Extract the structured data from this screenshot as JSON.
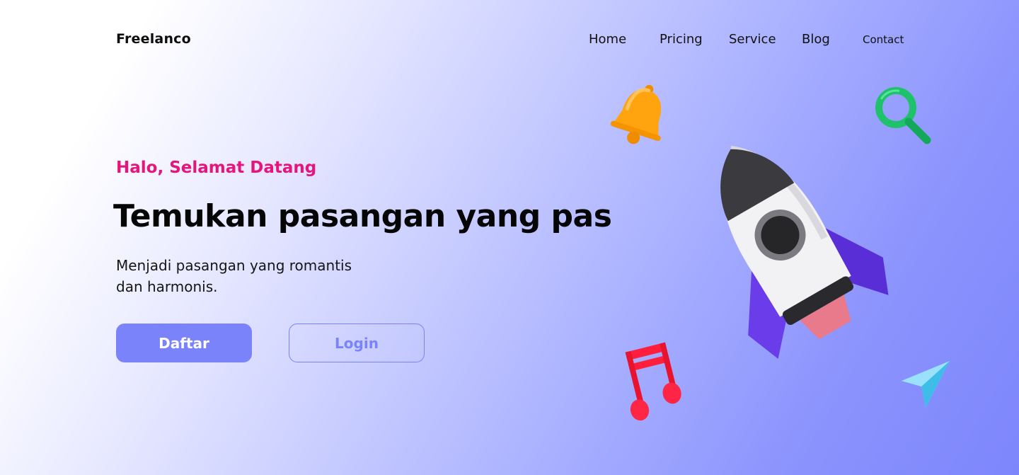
{
  "brand": {
    "name": "Freelanco"
  },
  "nav": {
    "items": [
      {
        "label": "Home"
      },
      {
        "label": "Pricing"
      },
      {
        "label": "Service"
      },
      {
        "label": "Blog"
      },
      {
        "label": "Contact"
      }
    ]
  },
  "hero": {
    "greeting": "Halo, Selamat Datang",
    "headline": "Temukan pasangan yang pas",
    "subtitle_line1": "Menjadi pasangan yang romantis",
    "subtitle_line2": "dan harmonis.",
    "primary_button": "Daftar",
    "secondary_button": "Login"
  },
  "illustrations": {
    "icons": [
      "bell-icon",
      "magnifier-icon",
      "rocket-icon",
      "music-note-icon",
      "paper-plane-icon"
    ]
  },
  "colors": {
    "accent": "#7b83fb",
    "greeting": "#e5157d",
    "text": "#050505",
    "bell": "#ffa30f",
    "magnifier": "#1fc26b",
    "music": "#ff1f3d",
    "plane": "#6fd3f7",
    "rocket_fins": "#6a3cea"
  }
}
